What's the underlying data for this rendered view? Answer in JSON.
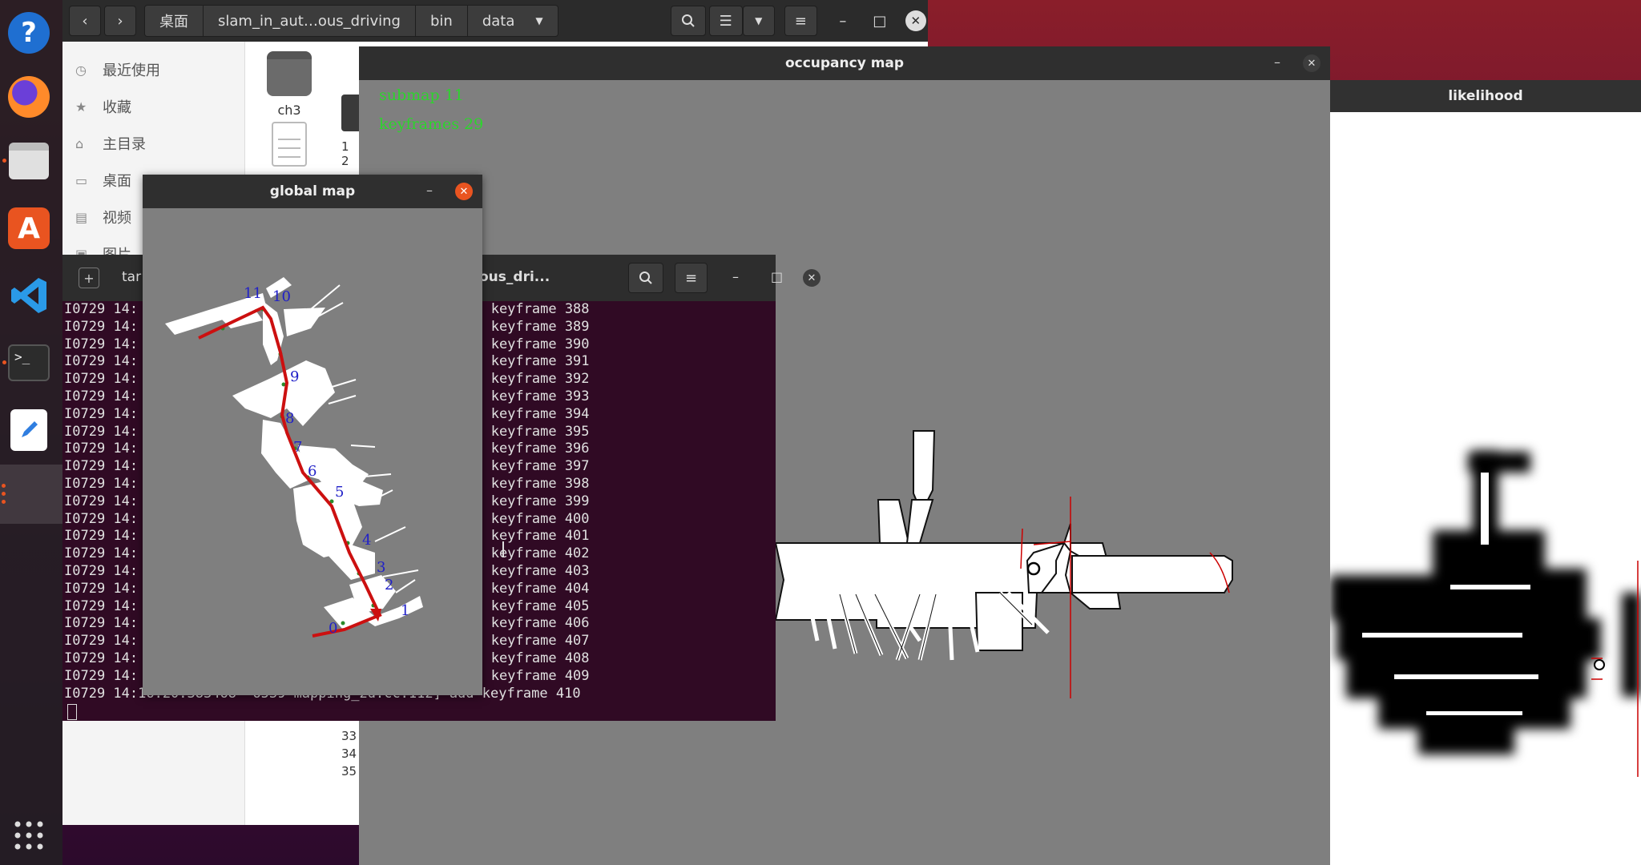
{
  "files": {
    "breadcrumbs": [
      "桌面",
      "slam_in_aut…ous_driving",
      "bin",
      "data"
    ],
    "sidebar": [
      {
        "label": "最近使用",
        "icon": "clock-icon"
      },
      {
        "label": "收藏",
        "icon": "star-icon"
      },
      {
        "label": "主目录",
        "icon": "home-icon"
      },
      {
        "label": "桌面",
        "icon": "folder-icon"
      },
      {
        "label": "视频",
        "icon": "video-icon"
      },
      {
        "label": "图片",
        "icon": "image-icon"
      }
    ],
    "folder_label": "ch3",
    "partial_digits": [
      "1",
      "2"
    ],
    "below_numbers": [
      "33",
      "34",
      "35"
    ]
  },
  "occupancy": {
    "title": "occupancy map",
    "submap": "submap 11",
    "keyframes": "keyframes 29"
  },
  "likelihood": {
    "title": "likelihood"
  },
  "global_map": {
    "title": "global map",
    "labels": [
      "0",
      "1",
      "2",
      "3",
      "4",
      "5",
      "6",
      "7",
      "8",
      "9",
      "10",
      "11"
    ]
  },
  "terminal": {
    "tab_label": "tar",
    "title_fragment": "ous_dri...",
    "prefix": "I0729 14:",
    "last_line_mid": "16.20.383468  6539 mapping_2d.cc:112]",
    "lines": [
      "dd keyframe 388",
      "dd keyframe 389",
      "dd keyframe 390",
      "dd keyframe 391",
      "dd keyframe 392",
      "dd keyframe 393",
      "dd keyframe 394",
      "dd keyframe 395",
      "dd keyframe 396",
      "dd keyframe 397",
      "dd keyframe 398",
      "dd keyframe 399",
      "dd keyframe 400",
      "dd keyframe 401",
      "dd keyframe 402",
      "dd keyframe 403",
      "dd keyframe 404",
      "dd keyframe 405",
      "dd keyframe 406",
      "dd keyframe 407",
      "dd keyframe 408",
      "dd keyframe 409",
      "add keyframe 410"
    ]
  },
  "colors": {
    "accent": "#e95420",
    "terminal_bg": "#300a24",
    "map_text": "#2cd52c"
  }
}
